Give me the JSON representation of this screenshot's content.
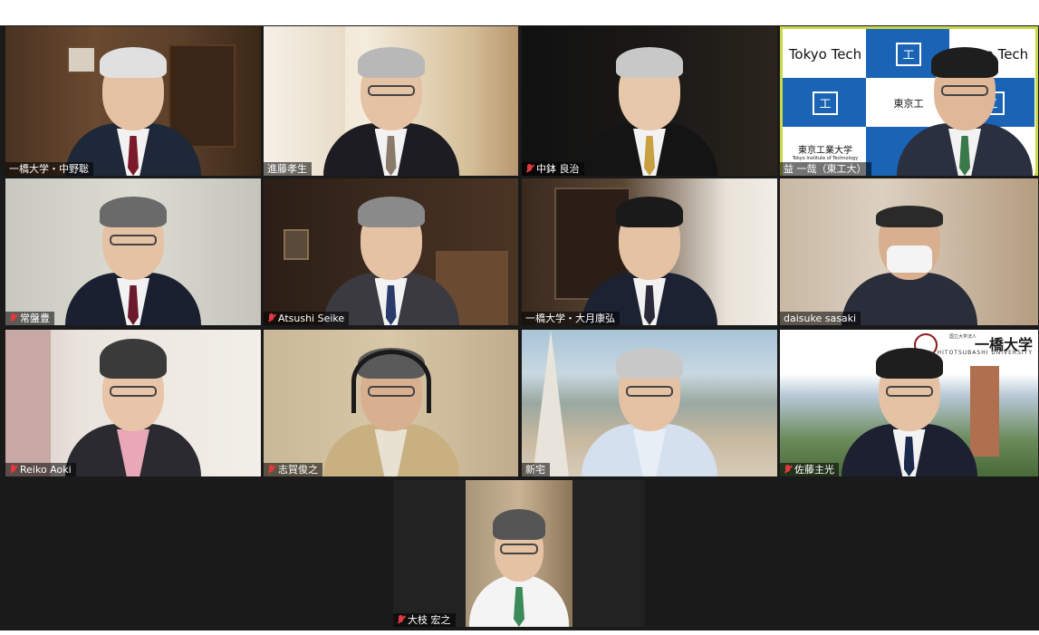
{
  "participants": [
    {
      "name": "一橋大学・中野聡",
      "muted": false
    },
    {
      "name": "進藤孝生",
      "muted": false
    },
    {
      "name": "中鉢 良治",
      "muted": true
    },
    {
      "name": "益 一哉（東工大）",
      "muted": false,
      "active_speaker": true
    },
    {
      "name": "常盤豊",
      "muted": true
    },
    {
      "name": "Atsushi Seike",
      "muted": true
    },
    {
      "name": "一橋大学・大月康弘",
      "muted": false
    },
    {
      "name": "daisuke sasaki",
      "muted": false
    },
    {
      "name": "Reiko Aoki",
      "muted": true
    },
    {
      "name": "志賀俊之",
      "muted": true
    },
    {
      "name": "新宅",
      "muted": false
    },
    {
      "name": "佐藤主光",
      "muted": true
    },
    {
      "name": "大枝 宏之",
      "muted": true
    }
  ],
  "backgrounds": {
    "tokyo_tech": {
      "brand_en": "Tokyo Tech",
      "brand_ja": "東京工業大学",
      "brand_sub": "Tokyo Institute of Technology",
      "brand_short": "東京工",
      "color": "#1a63b5"
    },
    "hitotsubashi": {
      "brand_ja": "一橋大学",
      "brand_en": "HITOTSUBASHI UNIVERSITY",
      "brand_prefix": "国立大学法人"
    }
  },
  "icons": {
    "muted": "mic-muted-icon",
    "logo": "university-logo-icon"
  },
  "colors": {
    "active_border": "#c8d84a",
    "mute_icon": "#e0393e",
    "stage": "#1a1a1a"
  }
}
